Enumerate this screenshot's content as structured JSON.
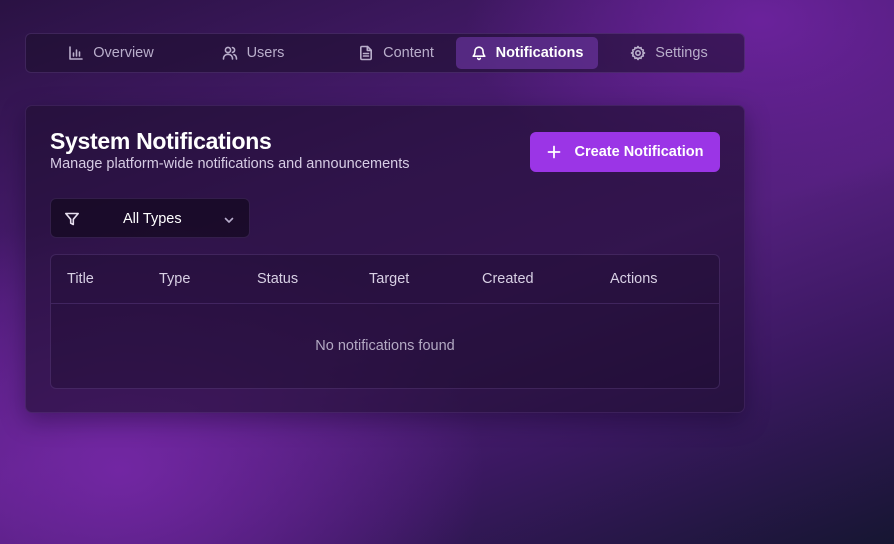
{
  "tabs": [
    {
      "label": "Overview",
      "icon": "bar-chart-icon",
      "active": false
    },
    {
      "label": "Users",
      "icon": "users-icon",
      "active": false
    },
    {
      "label": "Content",
      "icon": "document-icon",
      "active": false
    },
    {
      "label": "Notifications",
      "icon": "bell-icon",
      "active": true
    },
    {
      "label": "Settings",
      "icon": "gear-icon",
      "active": false
    }
  ],
  "card": {
    "title": "System Notifications",
    "subtitle": "Manage platform-wide notifications and announcements",
    "create_button_label": "Create Notification",
    "create_button_icon": "plus-icon"
  },
  "filter": {
    "selected": "All Types",
    "icon": "filter-icon"
  },
  "table": {
    "columns": [
      "Title",
      "Type",
      "Status",
      "Target",
      "Created",
      "Actions"
    ],
    "rows": [],
    "empty_message": "No notifications found"
  },
  "colors": {
    "accent": "#9b35e6",
    "active_tab": "#6c3aa3"
  }
}
